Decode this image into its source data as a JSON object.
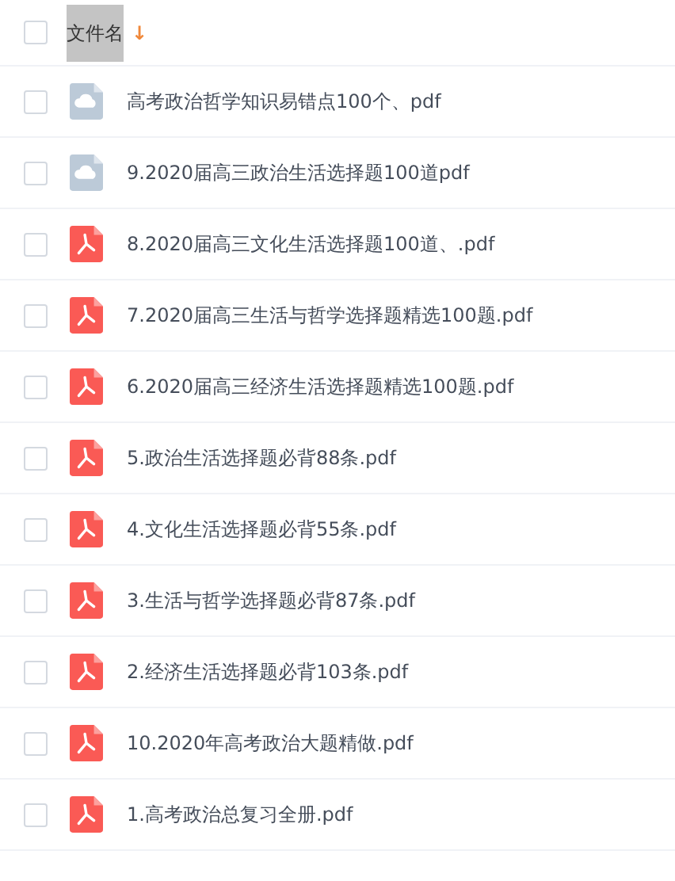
{
  "header": {
    "checked": false,
    "label": "文件名",
    "highlighted": true,
    "sort_icon": "↓"
  },
  "files": [
    {
      "kind": "cloud",
      "name": "高考政治哲学知识易错点100个、pdf",
      "checked": false
    },
    {
      "kind": "cloud",
      "name": "9.2020届高三政治生活选择题100道pdf",
      "checked": false
    },
    {
      "kind": "pdf",
      "name": "8.2020届高三文化生活选择题100道、.pdf",
      "checked": false
    },
    {
      "kind": "pdf",
      "name": "7.2020届高三生活与哲学选择题精选100题.pdf",
      "checked": false
    },
    {
      "kind": "pdf",
      "name": "6.2020届高三经济生活选择题精选100题.pdf",
      "checked": false
    },
    {
      "kind": "pdf",
      "name": "5.政治生活选择题必背88条.pdf",
      "checked": false
    },
    {
      "kind": "pdf",
      "name": "4.文化生活选择题必背55条.pdf",
      "checked": false
    },
    {
      "kind": "pdf",
      "name": "3.生活与哲学选择题必背87条.pdf",
      "checked": false
    },
    {
      "kind": "pdf",
      "name": "2.经济生活选择题必背103条.pdf",
      "checked": false
    },
    {
      "kind": "pdf",
      "name": "10.2020年高考政治大题精做.pdf",
      "checked": false
    },
    {
      "kind": "pdf",
      "name": "1.高考政治总复习全册.pdf",
      "checked": false
    }
  ]
}
